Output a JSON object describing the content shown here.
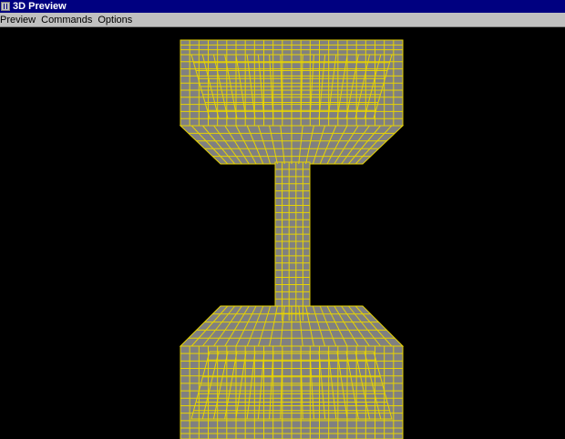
{
  "window": {
    "title": "3D Preview",
    "icon": "app-icon"
  },
  "menubar": {
    "items": [
      {
        "label": "Preview"
      },
      {
        "label": "Commands"
      },
      {
        "label": "Options"
      }
    ]
  },
  "viewport": {
    "background_color": "#000000",
    "mesh_fill_color": "#808080",
    "mesh_line_color": "#e8d400"
  }
}
